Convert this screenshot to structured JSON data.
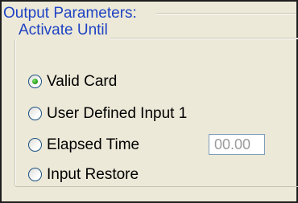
{
  "output_params": {
    "title": "Output Parameters:",
    "activate_until": {
      "label": "Activate Until",
      "options": [
        {
          "label": "Valid Card",
          "checked": true
        },
        {
          "label": "User Defined Input 1",
          "checked": false
        },
        {
          "label": "Elapsed Time",
          "checked": false
        },
        {
          "label": "Input Restore",
          "checked": false
        }
      ],
      "elapsed_time_value": "00.00"
    }
  }
}
